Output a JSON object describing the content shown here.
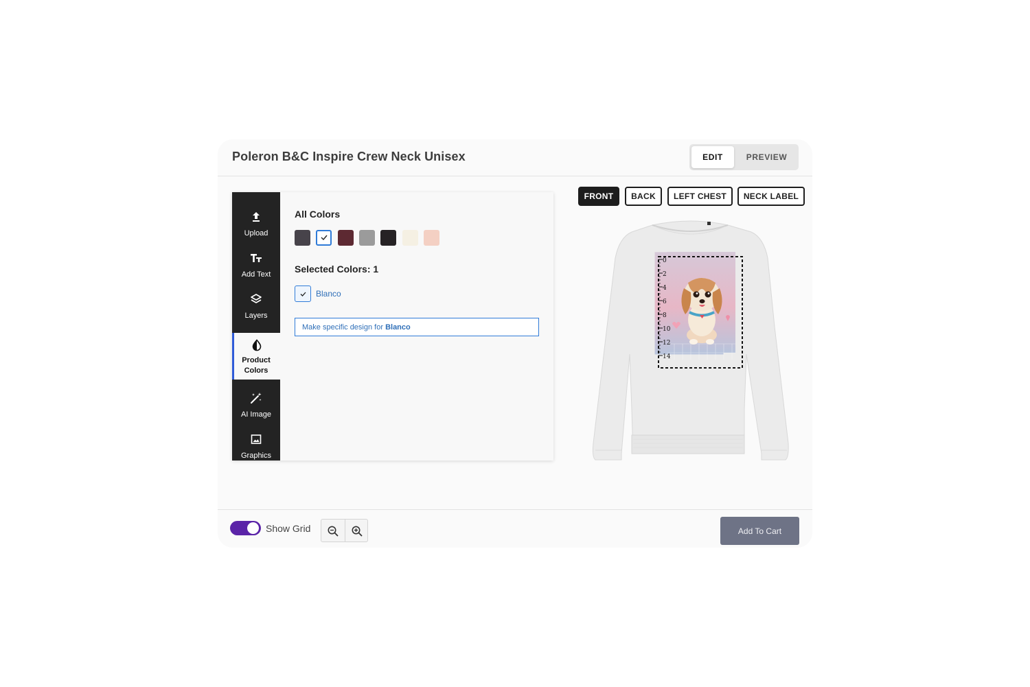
{
  "header": {
    "title": "Poleron B&C Inspire Crew Neck Unisex",
    "modes": {
      "edit": "EDIT",
      "preview": "PREVIEW",
      "active": "edit"
    }
  },
  "toolbar": {
    "items": [
      {
        "label": "Upload",
        "icon": "upload-icon"
      },
      {
        "label": "Add Text",
        "icon": "text-icon"
      },
      {
        "label": "Layers",
        "icon": "layers-icon"
      },
      {
        "label": "Product Colors",
        "icon": "color-drop-icon",
        "active": true
      },
      {
        "label": "AI Image",
        "icon": "magic-wand-icon"
      },
      {
        "label": "Graphics",
        "icon": "image-icon"
      }
    ]
  },
  "colors_panel": {
    "all_colors_title": "All Colors",
    "swatches": [
      "#47434a",
      "#ffffff",
      "#5d2932",
      "#9b9b9b",
      "#262224",
      "#f5f0e3",
      "#f4d0c3"
    ],
    "selected_index": 1,
    "selected_title": "Selected Colors: 1",
    "selected_items": [
      {
        "name": "Blanco"
      }
    ],
    "design_button_prefix": "Make specific design for",
    "design_button_color": "Blanco"
  },
  "views": {
    "items": [
      "FRONT",
      "BACK",
      "LEFT CHEST",
      "NECK LABEL"
    ],
    "active": "FRONT"
  },
  "canvas": {
    "ruler_ticks": [
      "0",
      "2",
      "4",
      "6",
      "8",
      "10",
      "12",
      "14"
    ]
  },
  "footer": {
    "show_grid_label": "Show Grid",
    "show_grid_on": true,
    "zoom_out_icon": "zoom-out-icon",
    "zoom_in_icon": "zoom-in-icon",
    "add_to_cart": "Add To Cart"
  },
  "colors": {
    "accent_blue": "#2f7bd8",
    "toggle_purple": "#5b24a8",
    "cart_button": "#6e7386",
    "toolbar_bg": "#232323"
  }
}
